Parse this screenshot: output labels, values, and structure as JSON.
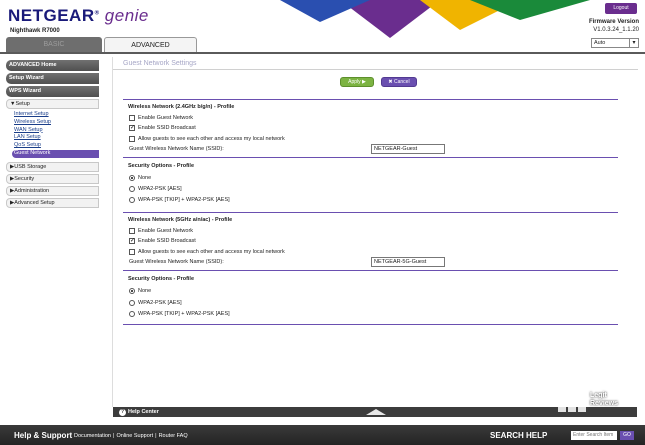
{
  "header": {
    "brand_netgear": "NETGEAR",
    "brand_genie": "genie",
    "brand_reg": "®",
    "model": "Nighthawk R7000",
    "logout_label": "Logout",
    "firmware_label": "Firmware Version",
    "firmware_value": "V1.0.3.24_1.1.20",
    "language_selected": "Auto"
  },
  "tabs": [
    {
      "label": "BASIC"
    },
    {
      "label": "ADVANCED"
    }
  ],
  "sidebar": {
    "main_items": [
      "ADVANCED Home",
      "Setup Wizard",
      "WPS Wizard"
    ],
    "setup_group": "▼Setup",
    "setup_items": [
      "Internet Setup",
      "Wireless Setup",
      "WAN Setup",
      "LAN Setup",
      "QoS Setup",
      "Guest Network"
    ],
    "groups": [
      "▶USB Storage",
      "▶Security",
      "▶Administration",
      "▶Advanced Setup"
    ]
  },
  "main": {
    "title": "Guest Network Settings",
    "apply_label": "Apply ▶",
    "cancel_label": "✖ Cancel",
    "band24": {
      "title": "Wireless Network (2.4GHz b/g/n) - Profile",
      "enable_guest": "Enable Guest Network",
      "enable_ssid": "Enable SSID Broadcast",
      "allow_guests": "Allow guests to see each other and access my local network",
      "ssid_label": "Guest Wireless Network Name (SSID):",
      "ssid_value": "NETGEAR-Guest",
      "security_title": "Security Options - Profile",
      "options": [
        "None",
        "WPA2-PSK [AES]",
        "WPA-PSK [TKIP] + WPA2-PSK [AES]"
      ]
    },
    "band5": {
      "title": "Wireless Network (5GHz a/n/ac) - Profile",
      "enable_guest": "Enable Guest Network",
      "enable_ssid": "Enable SSID Broadcast",
      "allow_guests": "Allow guests to see each other and access my local network",
      "ssid_label": "Guest Wireless Network Name (SSID):",
      "ssid_value": "NETGEAR-5G-Guest",
      "security_title": "Security Options - Profile",
      "options": [
        "None",
        "WPA2-PSK [AES]",
        "WPA-PSK [TKIP] + WPA2-PSK [AES]"
      ]
    }
  },
  "helpbar": {
    "label": "Help Center",
    "q": "?"
  },
  "footer": {
    "help_support": "Help & Support",
    "links": [
      "Documentation",
      "Online Support",
      "Router FAQ"
    ],
    "search_label": "SEARCH HELP",
    "search_placeholder": "Enter Search Item",
    "go": "GO"
  },
  "watermark": {
    "line1": "Legit",
    "line2": "Reviews"
  },
  "colors": {
    "accent": "#6a4fb0",
    "apply": "#7cb342"
  }
}
